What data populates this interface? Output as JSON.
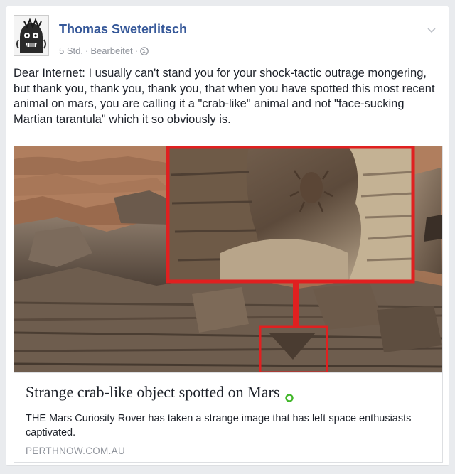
{
  "post": {
    "author_name": "Thomas Sweterlitsch",
    "time": "5 Std.",
    "separator": "·",
    "edited": "Bearbeitet",
    "text": "Dear Internet: I usually can't stand you for your shock-tactic outrage mongering, but thank you, thank you, thank you, that when you have spotted this most recent animal on mars, you are calling it a \"crab-like\" animal and not \"face-sucking Martian tarantula\" which it so obviously is."
  },
  "link": {
    "title": "Strange crab-like object spotted on Mars",
    "description": "THE Mars Curiosity Rover has taken a strange image that has left space enthusiasts captivated.",
    "domain": "PERTHNOW.COM.AU"
  },
  "icons": {
    "globe": "globe-icon",
    "chevron": "chevron-down-icon",
    "verified": "verified-dot-icon",
    "avatar": "avatar-image"
  },
  "colors": {
    "author_link": "#365899",
    "meta_text": "#90949c",
    "body_text": "#1d2129",
    "highlight_frame": "#e02020",
    "verified_green": "#42b72a"
  }
}
